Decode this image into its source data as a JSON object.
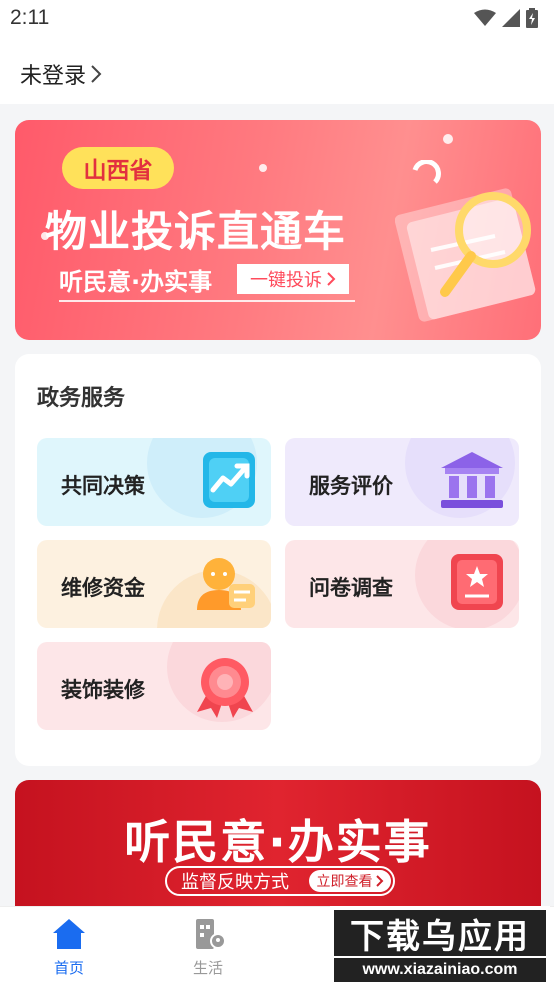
{
  "status_bar": {
    "time": "2:11"
  },
  "header": {
    "login_text": "未登录"
  },
  "banner_top": {
    "province": "山西省",
    "title": "物业投诉直通车",
    "subtitle": "听民意·办实事",
    "button": "一键投诉"
  },
  "gov_services": {
    "title": "政务服务",
    "items": [
      {
        "label": "共同决策",
        "icon": "trend-chart-icon",
        "bg": "#dff6fc"
      },
      {
        "label": "服务评价",
        "icon": "building-icon",
        "bg": "#efeafc"
      },
      {
        "label": "维修资金",
        "icon": "user-chat-icon",
        "bg": "#fdf1e0"
      },
      {
        "label": "问卷调查",
        "icon": "survey-star-icon",
        "bg": "#fde6e8"
      },
      {
        "label": "装饰装修",
        "icon": "medal-icon",
        "bg": "#fde6e8"
      }
    ]
  },
  "banner_bottom": {
    "title": "听民意·办实事",
    "pill_text": "监督反映方式",
    "pill_button": "立即查看"
  },
  "tabbar": {
    "tabs": [
      {
        "label": "首页",
        "icon": "home-icon",
        "active": true,
        "color": "#1a6cf0"
      },
      {
        "label": "生活",
        "icon": "building-location-icon",
        "active": false,
        "color": "#999999"
      }
    ]
  },
  "watermark": {
    "line1": "下载乌应用",
    "line2": "www.xiazainiao.com"
  }
}
